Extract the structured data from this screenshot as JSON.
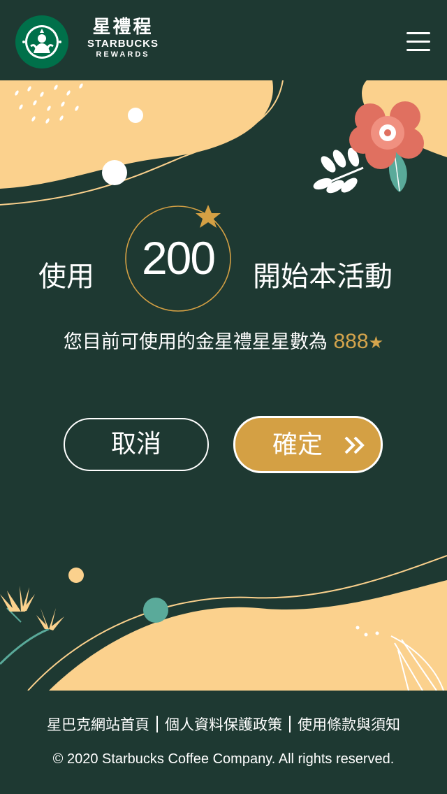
{
  "header": {
    "brand_cn": "星禮程",
    "brand_en": "STARBUCKS",
    "brand_sub": "REWARDS"
  },
  "offer": {
    "use_label": "使用",
    "stars_required": "200",
    "start_label": "開始本活動",
    "balance_label": "您目前可使用的金星禮星星數為",
    "balance_value": "888",
    "balance_star": "★"
  },
  "buttons": {
    "cancel_label": "取消",
    "confirm_label": "確定"
  },
  "footer": {
    "links": [
      "星巴克網站首頁",
      "個人資料保護政策",
      "使用條款與須知"
    ],
    "copyright": "© 2020 Starbucks Coffee Company. All rights reserved."
  },
  "colors": {
    "background": "#1e3932",
    "gold": "#d4a044",
    "cream": "#fbd18d",
    "flower": "#e07060",
    "teal": "#5aaa9a"
  },
  "icons": {
    "logo": "starbucks-siren-logo",
    "menu": "hamburger-menu-icon",
    "star": "gold-star-icon",
    "confirm_arrow": "double-chevron-right-icon"
  }
}
